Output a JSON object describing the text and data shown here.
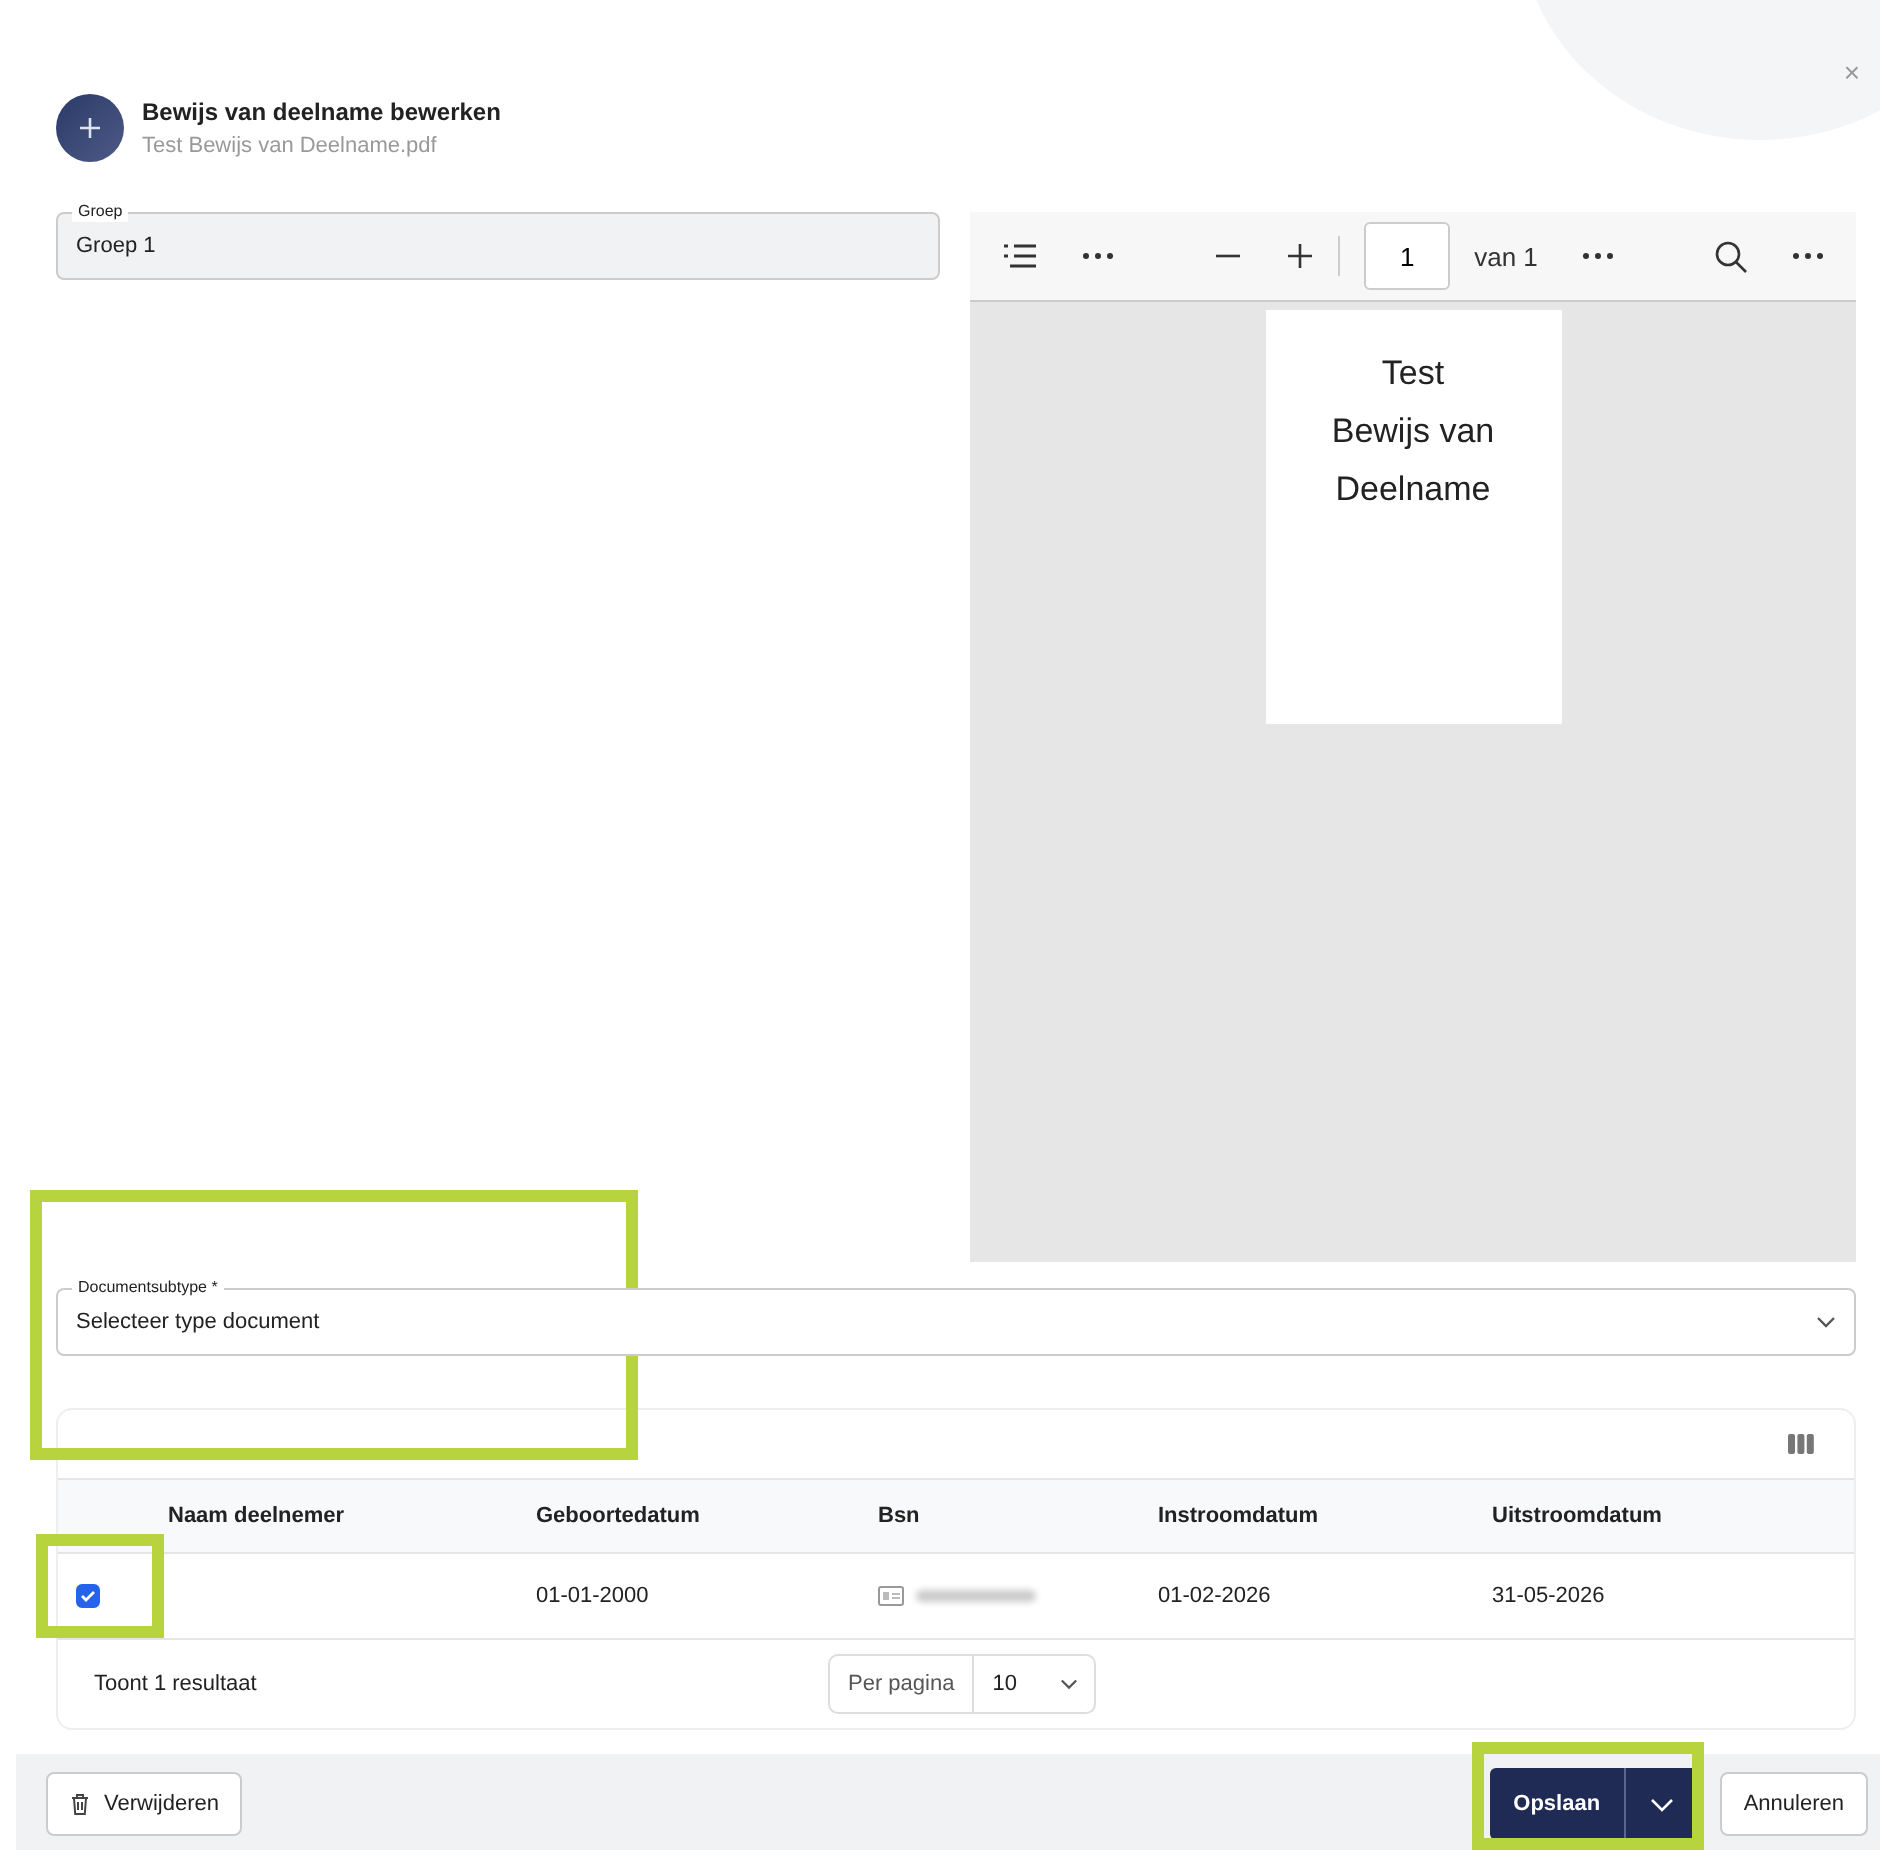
{
  "dialog": {
    "close": "×",
    "title": "Bewijs van deelname bewerken",
    "subtitle": "Test Bewijs van Deelname.pdf"
  },
  "group_field": {
    "label": "Groep",
    "value": "Groep 1"
  },
  "pdf_viewer": {
    "page_input": "1",
    "page_total": "van 1",
    "page_lines": [
      "Test",
      "Bewijs van",
      "Deelname"
    ]
  },
  "subtype_field": {
    "label": "Documentsubtype *",
    "placeholder": "Selecteer type document"
  },
  "table": {
    "columns": [
      "Naam deelnemer",
      "Geboortedatum",
      "Bsn",
      "Instroomdatum",
      "Uitstroomdatum"
    ],
    "rows": [
      {
        "selected": true,
        "cells": [
          "",
          "01-01-2000",
          "",
          "01-02-2026",
          "31-05-2026"
        ]
      }
    ],
    "result_count": "Toont 1 resultaat",
    "per_page_label": "Per pagina",
    "per_page": "10"
  },
  "footer": {
    "delete": "Verwijderen",
    "save": "Opslaan",
    "cancel": "Annuleren"
  }
}
